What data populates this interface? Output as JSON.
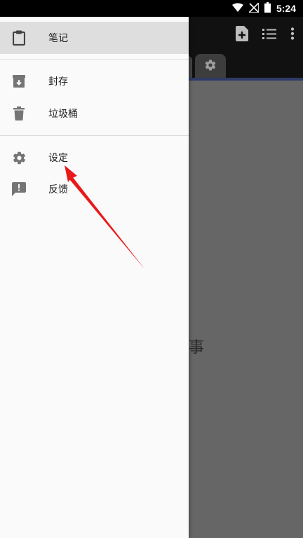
{
  "status_bar": {
    "time": "5:24",
    "icons": [
      "wifi-icon",
      "no-signal-icon",
      "battery-icon"
    ]
  },
  "app_bar": {
    "actions": [
      "new-note-icon",
      "list-icon",
      "more-vert-icon"
    ]
  },
  "tabs": {
    "settings_icon": "gear-icon"
  },
  "main": {
    "empty_text": "记事"
  },
  "drawer": {
    "items": [
      {
        "label": "笔记",
        "icon": "clipboard-icon",
        "active": true
      },
      {
        "label": "封存",
        "icon": "archive-icon"
      },
      {
        "label": "垃圾桶",
        "icon": "trash-icon"
      },
      {
        "label": "设定",
        "icon": "gear-icon"
      },
      {
        "label": "反馈",
        "icon": "feedback-icon"
      }
    ]
  },
  "annotation": {
    "arrow_color": "#e8191a",
    "points_to": "设定"
  },
  "colors": {
    "drawer_active_bg": "#dedede",
    "overlay": "#666666",
    "tab_accent": "#2e3a66"
  }
}
